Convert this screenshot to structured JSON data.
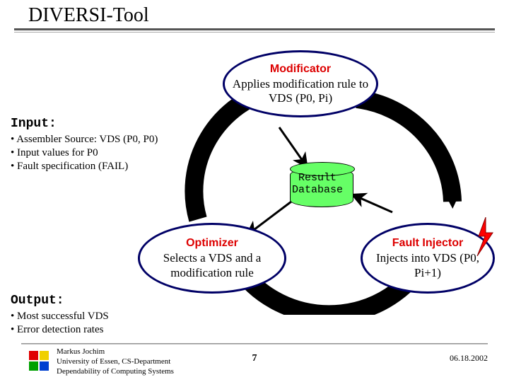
{
  "title": "DIVERSI-Tool",
  "input": {
    "label": "Input:",
    "items": [
      "Assembler Source: VDS (P0, P0)",
      "Input values for P0",
      "Fault specification (FAIL)"
    ]
  },
  "output": {
    "label": "Output:",
    "items": [
      "Most successful VDS",
      "Error detection rates"
    ]
  },
  "cycle": {
    "modificator": {
      "title": "Modificator",
      "text": "Applies modification rule to VDS (P0, Pi)"
    },
    "optimizer": {
      "title": "Optimizer",
      "text": "Selects a VDS and a modification rule"
    },
    "fault_injector": {
      "title": "Fault Injector",
      "text": "Injects into VDS (P0, Pi+1)"
    },
    "result_db": "Result\nDatabase"
  },
  "footer": {
    "author": "Markus Jochim",
    "affiliation": "University of Essen, CS-Department",
    "group": "Dependability of Computing Systems",
    "page": "7",
    "date": "06.18.2002"
  }
}
